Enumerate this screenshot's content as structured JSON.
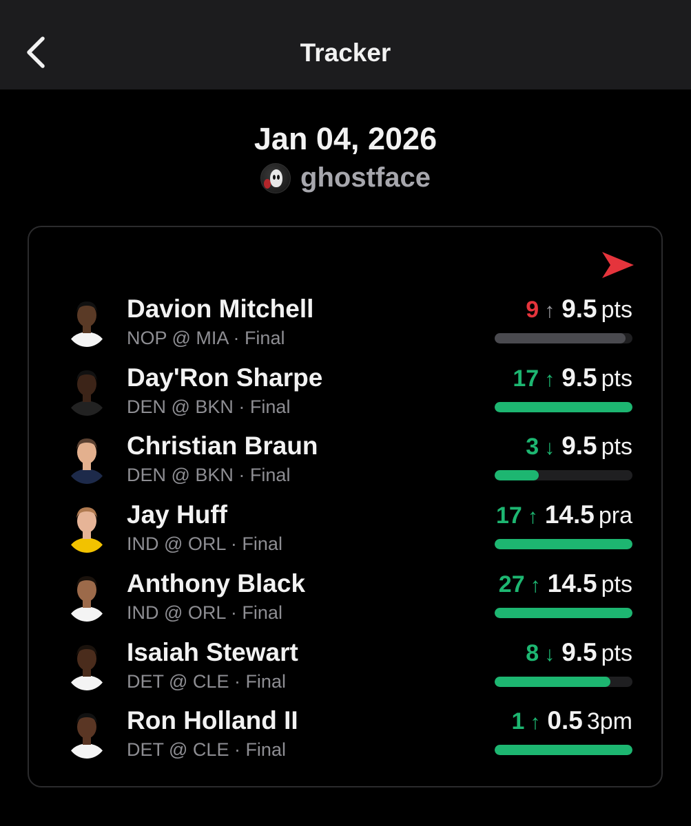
{
  "header": {
    "title": "Tracker"
  },
  "date": "Jan 04, 2026",
  "user": {
    "name": "ghostface"
  },
  "colors": {
    "hit": "#1db671",
    "miss": "#e5343c",
    "neutral": "#4a4a4f",
    "track": "#1f1f21"
  },
  "picks": [
    {
      "player": "Davion Mitchell",
      "game": "NOP @ MIA · Final",
      "actual": "9",
      "direction": "↑",
      "line": "9.5",
      "unit": "pts",
      "status": "miss",
      "progress": 0.95
    },
    {
      "player": "Day'Ron Sharpe",
      "game": "DEN @ BKN · Final",
      "actual": "17",
      "direction": "↑",
      "line": "9.5",
      "unit": "pts",
      "status": "hit",
      "progress": 1.0
    },
    {
      "player": "Christian Braun",
      "game": "DEN @ BKN · Final",
      "actual": "3",
      "direction": "↓",
      "line": "9.5",
      "unit": "pts",
      "status": "hit",
      "progress": 0.32
    },
    {
      "player": "Jay Huff",
      "game": "IND @ ORL · Final",
      "actual": "17",
      "direction": "↑",
      "line": "14.5",
      "unit": "pra",
      "status": "hit",
      "progress": 1.0
    },
    {
      "player": "Anthony Black",
      "game": "IND @ ORL · Final",
      "actual": "27",
      "direction": "↑",
      "line": "14.5",
      "unit": "pts",
      "status": "hit",
      "progress": 1.0
    },
    {
      "player": "Isaiah Stewart",
      "game": "DET @ CLE · Final",
      "actual": "8",
      "direction": "↓",
      "line": "9.5",
      "unit": "pts",
      "status": "hit",
      "progress": 0.84
    },
    {
      "player": "Ron Holland II",
      "game": "DET @ CLE · Final",
      "actual": "1",
      "direction": "↑",
      "line": "0.5",
      "unit": "3pm",
      "status": "hit",
      "progress": 1.0
    }
  ]
}
